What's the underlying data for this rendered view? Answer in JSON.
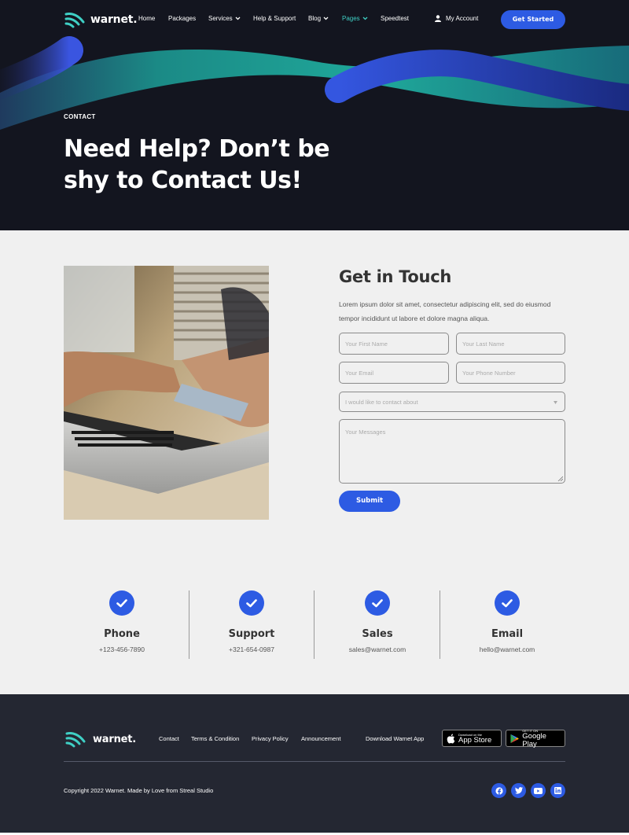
{
  "brand": {
    "name": "warnet."
  },
  "nav": {
    "links": [
      {
        "label": "Home"
      },
      {
        "label": "Packages"
      },
      {
        "label": "Services"
      },
      {
        "label": "Help & Support"
      },
      {
        "label": "Blog"
      },
      {
        "label": "Pages"
      },
      {
        "label": "Speedtest"
      }
    ],
    "account_label": "My Account",
    "cta_label": "Get Started"
  },
  "hero": {
    "eyebrow": "CONTACT",
    "title": "Need Help? Don’t be shy to Contact Us!"
  },
  "contact": {
    "title": "Get in Touch",
    "description": "Lorem ipsum dolor sit amet, consectetur adipiscing elit, sed do eiusmod tempor incididunt ut labore et dolore magna aliqua.",
    "fields": {
      "first_name_placeholder": "Your First Name",
      "last_name_placeholder": "Your Last Name",
      "email_placeholder": "Your Email",
      "phone_placeholder": "Your Phone Number",
      "topic_value": "I would like to contact about",
      "message_placeholder": "Your Messages"
    },
    "submit_label": "Submit"
  },
  "info": [
    {
      "title": "Phone",
      "value": "+123-456-7890"
    },
    {
      "title": "Support",
      "value": "+321-654-0987"
    },
    {
      "title": "Sales",
      "value": "sales@warnet.com"
    },
    {
      "title": "Email",
      "value": "hello@warnet.com"
    }
  ],
  "footer": {
    "links": [
      {
        "label": "Contact"
      },
      {
        "label": "Terms & Condition"
      },
      {
        "label": "Privacy Policy"
      },
      {
        "label": "Announcement"
      }
    ],
    "download_label": "Download Warnet App",
    "app_store": {
      "small": "Download on the",
      "big": "App Store"
    },
    "google_play": {
      "small": "GET IT ON",
      "big": "Google Play"
    },
    "copyright": "Copyright 2022 Warnet. Made by Love from Streal Studio",
    "social": [
      "facebook-icon",
      "twitter-icon",
      "youtube-icon",
      "linkedin-icon"
    ]
  },
  "colors": {
    "accent": "#2d5be3",
    "teal": "#3fd0c5",
    "hero_bg": "#13151f",
    "footer_bg": "#242732"
  }
}
